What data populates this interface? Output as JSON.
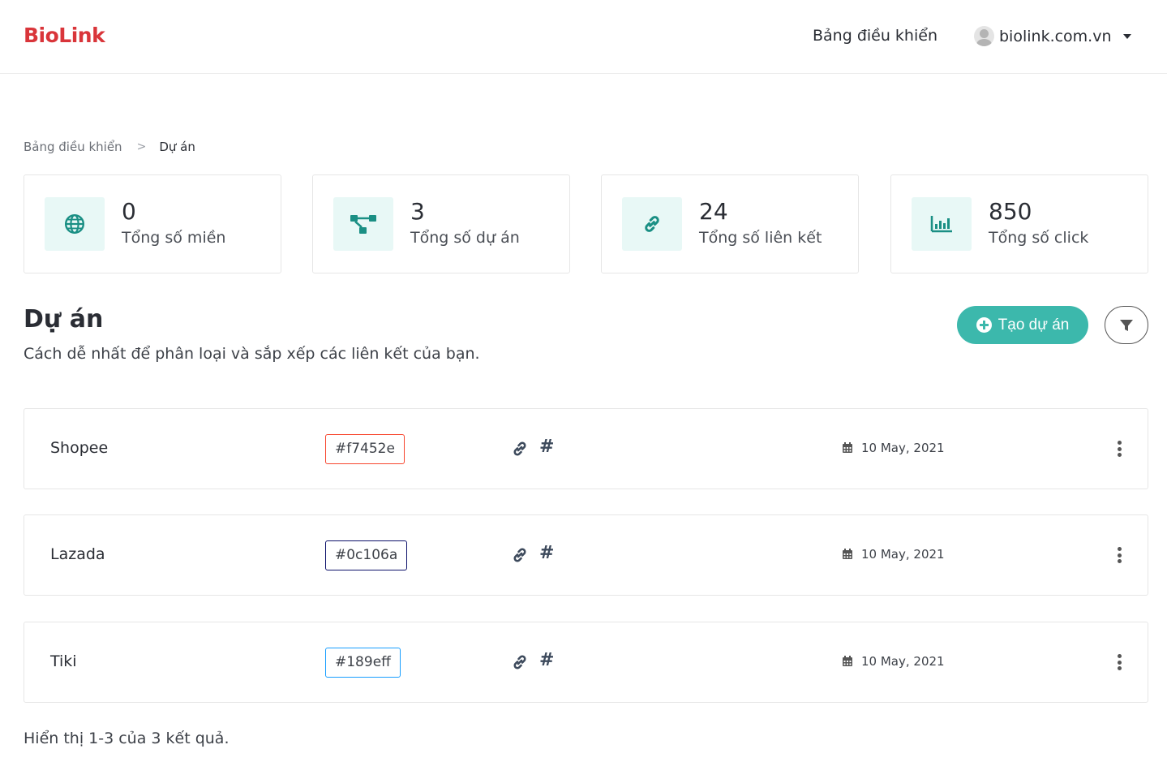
{
  "brand": {
    "name": "BioLink",
    "color": "#d9353a"
  },
  "nav": {
    "dashboard_label": "Bảng điều khiển",
    "user_label": "biolink.com.vn",
    "avatar_icon": "user-avatar-icon",
    "caret_icon": "caret-down-icon"
  },
  "breadcrumb": {
    "parent": "Bảng điều khiển",
    "separator": ">",
    "current": "Dự án"
  },
  "stats": [
    {
      "value": "0",
      "label": "Tổng số miền",
      "icon": "globe-icon"
    },
    {
      "value": "3",
      "label": "Tổng số dự án",
      "icon": "project-diagram-icon"
    },
    {
      "value": "24",
      "label": "Tổng số liên kết",
      "icon": "link-icon"
    },
    {
      "value": "850",
      "label": "Tổng số click",
      "icon": "bar-chart-icon"
    }
  ],
  "section": {
    "title": "Dự án",
    "description": "Cách dễ nhất để phân loại và sắp xếp các liên kết của bạn.",
    "create_label": "Tạo dự án",
    "create_icon": "plus-circle-icon",
    "filter_icon": "filter-icon"
  },
  "projects": [
    {
      "name": "Shopee",
      "color": "#f7452e",
      "date": "10 May, 2021"
    },
    {
      "name": "Lazada",
      "color": "#0c106a",
      "date": "10 May, 2021"
    },
    {
      "name": "Tiki",
      "color": "#189eff",
      "date": "10 May, 2021"
    }
  ],
  "footer": {
    "results_text": "Hiển thị 1-3 của 3 kết quả."
  },
  "colors": {
    "accent": "#3cb8ac",
    "icon_bg": "#e8f8f6"
  }
}
